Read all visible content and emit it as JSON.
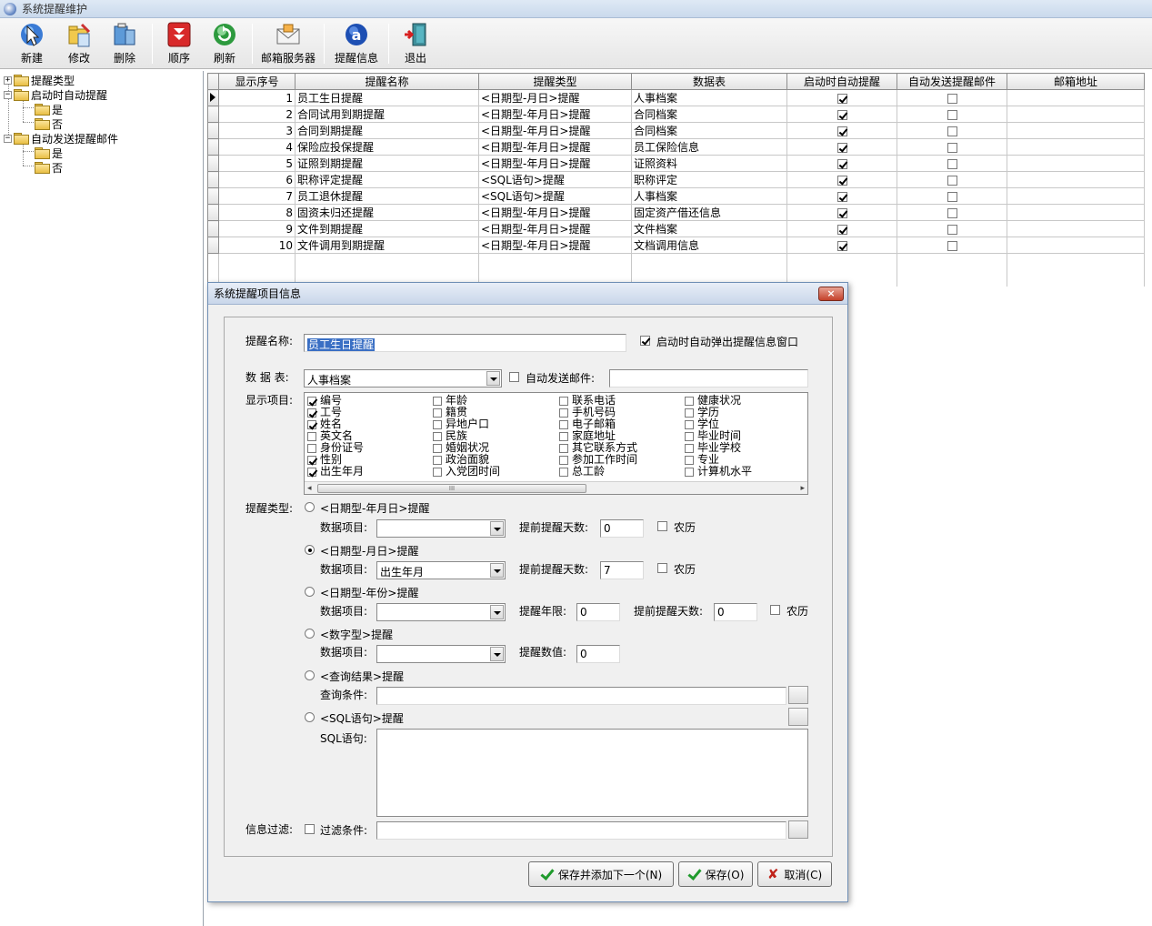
{
  "window": {
    "title": "系统提醒维护"
  },
  "toolbar": {
    "new": "新建",
    "edit": "修改",
    "delete": "删除",
    "order": "顺序",
    "refresh": "刷新",
    "mail_server": "邮箱服务器",
    "reminder_info": "提醒信息",
    "exit": "退出"
  },
  "tree": {
    "root1": "提醒类型",
    "root2": "启动时自动提醒",
    "root2_yes": "是",
    "root2_no": "否",
    "root3": "自动发送提醒邮件",
    "root3_yes": "是",
    "root3_no": "否"
  },
  "grid": {
    "columns": [
      "显示序号",
      "提醒名称",
      "提醒类型",
      "数据表",
      "启动时自动提醒",
      "自动发送提醒邮件",
      "邮箱地址"
    ],
    "rows": [
      {
        "seq": "1",
        "name": "员工生日提醒",
        "type": "<日期型-月日>提醒",
        "table": "人事档案",
        "auto": true,
        "mail": false,
        "email": ""
      },
      {
        "seq": "2",
        "name": "合同试用到期提醒",
        "type": "<日期型-年月日>提醒",
        "table": "合同档案",
        "auto": true,
        "mail": false,
        "email": ""
      },
      {
        "seq": "3",
        "name": "合同到期提醒",
        "type": "<日期型-年月日>提醒",
        "table": "合同档案",
        "auto": true,
        "mail": false,
        "email": ""
      },
      {
        "seq": "4",
        "name": "保险应投保提醒",
        "type": "<日期型-年月日>提醒",
        "table": "员工保险信息",
        "auto": true,
        "mail": false,
        "email": ""
      },
      {
        "seq": "5",
        "name": "证照到期提醒",
        "type": "<日期型-年月日>提醒",
        "table": "证照资料",
        "auto": true,
        "mail": false,
        "email": ""
      },
      {
        "seq": "6",
        "name": "职称评定提醒",
        "type": "<SQL语句>提醒",
        "table": "职称评定",
        "auto": true,
        "mail": false,
        "email": ""
      },
      {
        "seq": "7",
        "name": "员工退休提醒",
        "type": "<SQL语句>提醒",
        "table": "人事档案",
        "auto": true,
        "mail": false,
        "email": ""
      },
      {
        "seq": "8",
        "name": "固资未归还提醒",
        "type": "<日期型-年月日>提醒",
        "table": "固定资产借还信息",
        "auto": true,
        "mail": false,
        "email": ""
      },
      {
        "seq": "9",
        "name": "文件到期提醒",
        "type": "<日期型-年月日>提醒",
        "table": "文件档案",
        "auto": true,
        "mail": false,
        "email": ""
      },
      {
        "seq": "10",
        "name": "文件调用到期提醒",
        "type": "<日期型-年月日>提醒",
        "table": "文档调用信息",
        "auto": true,
        "mail": false,
        "email": ""
      }
    ]
  },
  "dialog": {
    "title": "系统提醒项目信息",
    "close": "×",
    "name_label": "提醒名称:",
    "name_value": "员工生日提醒",
    "popup_label": "启动时自动弹出提醒信息窗口",
    "table_label": "数 据 表:",
    "table_value": "人事档案",
    "auto_mail_label": "自动发送邮件:",
    "auto_mail_value": "",
    "display_label": "显示项目:",
    "display_items": [
      {
        "label": "编号",
        "checked": true
      },
      {
        "label": "工号",
        "checked": true
      },
      {
        "label": "姓名",
        "checked": true
      },
      {
        "label": "英文名",
        "checked": false
      },
      {
        "label": "身份证号",
        "checked": false
      },
      {
        "label": "性别",
        "checked": true
      },
      {
        "label": "出生年月",
        "checked": true
      },
      {
        "label": "年龄",
        "checked": false
      },
      {
        "label": "籍贯",
        "checked": false
      },
      {
        "label": "异地户口",
        "checked": false
      },
      {
        "label": "民族",
        "checked": false
      },
      {
        "label": "婚姻状况",
        "checked": false
      },
      {
        "label": "政治面貌",
        "checked": false
      },
      {
        "label": "入党团时间",
        "checked": false
      },
      {
        "label": "联系电话",
        "checked": false
      },
      {
        "label": "手机号码",
        "checked": false
      },
      {
        "label": "电子邮箱",
        "checked": false
      },
      {
        "label": "家庭地址",
        "checked": false
      },
      {
        "label": "其它联系方式",
        "checked": false
      },
      {
        "label": "参加工作时间",
        "checked": false
      },
      {
        "label": "总工龄",
        "checked": false
      },
      {
        "label": "健康状况",
        "checked": false
      },
      {
        "label": "学历",
        "checked": false
      },
      {
        "label": "学位",
        "checked": false
      },
      {
        "label": "毕业时间",
        "checked": false
      },
      {
        "label": "毕业学校",
        "checked": false
      },
      {
        "label": "专业",
        "checked": false
      },
      {
        "label": "计算机水平",
        "checked": false
      }
    ],
    "scroll_thumb": "III",
    "type_label": "提醒类型:",
    "opt1_label": "<日期型-年月日>提醒",
    "opt1_item_label": "数据项目:",
    "opt1_item_value": "",
    "opt1_days_label": "提前提醒天数:",
    "opt1_days_value": "0",
    "opt1_lunar": "农历",
    "opt2_label": "<日期型-月日>提醒",
    "opt2_item_label": "数据项目:",
    "opt2_item_value": "出生年月",
    "opt2_days_label": "提前提醒天数:",
    "opt2_days_value": "7",
    "opt2_lunar": "农历",
    "opt3_label": "<日期型-年份>提醒",
    "opt3_item_label": "数据项目:",
    "opt3_item_value": "",
    "opt3_years_label": "提醒年限:",
    "opt3_years_value": "0",
    "opt3_days_label": "提前提醒天数:",
    "opt3_days_value": "0",
    "opt3_lunar": "农历",
    "opt4_label": "<数字型>提醒",
    "opt4_item_label": "数据项目:",
    "opt4_item_value": "",
    "opt4_value_label": "提醒数值:",
    "opt4_value": "0",
    "opt5_label": "<查询结果>提醒",
    "opt5_cond_label": "查询条件:",
    "opt5_cond_value": "",
    "opt6_label": "<SQL语句>提醒",
    "opt6_sql_label": "SQL语句:",
    "filter_label": "信息过滤:",
    "filter_cond_label": "过滤条件:",
    "filter_value": "",
    "btn_save_next": "保存并添加下一个(N)",
    "btn_save": "保存(O)",
    "btn_cancel": "取消(C)"
  }
}
